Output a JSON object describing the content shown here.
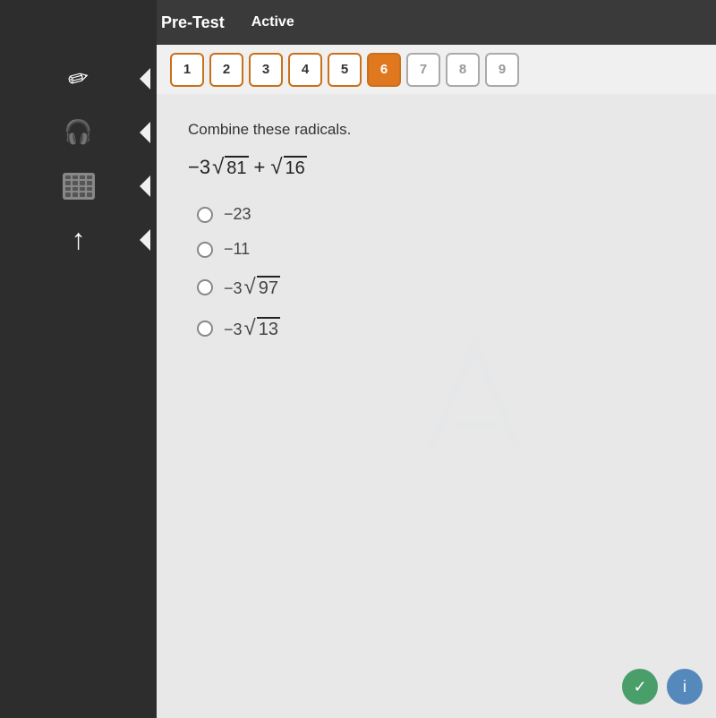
{
  "header": {
    "title": "Pre-Test",
    "status": "Active"
  },
  "tabs": {
    "items": [
      {
        "label": "1",
        "state": "normal"
      },
      {
        "label": "2",
        "state": "normal"
      },
      {
        "label": "3",
        "state": "normal"
      },
      {
        "label": "4",
        "state": "normal"
      },
      {
        "label": "5",
        "state": "normal"
      },
      {
        "label": "6",
        "state": "active"
      },
      {
        "label": "7",
        "state": "inactive"
      },
      {
        "label": "8",
        "state": "inactive"
      },
      {
        "label": "9",
        "state": "inactive"
      }
    ]
  },
  "sidebar": {
    "items": [
      {
        "name": "pencil",
        "icon": "✏"
      },
      {
        "name": "headphone",
        "icon": "🎧"
      },
      {
        "name": "calculator",
        "icon": "calc"
      },
      {
        "name": "arrow-up",
        "icon": "↑"
      }
    ]
  },
  "question": {
    "prompt": "Combine these radicals.",
    "expression": "-3√81 + √16",
    "options": [
      {
        "value": "-23",
        "label": "-23"
      },
      {
        "value": "-11",
        "label": "-11"
      },
      {
        "value": "-3sqrt97",
        "label": "-3√97"
      },
      {
        "value": "-3sqrt13",
        "label": "-3√13"
      }
    ]
  },
  "colors": {
    "accent_orange": "#e07820",
    "border_orange": "#c8711a",
    "sidebar_bg": "#2d2d2d",
    "header_bg": "#3a3a3a",
    "content_bg": "#e8e8e8"
  }
}
